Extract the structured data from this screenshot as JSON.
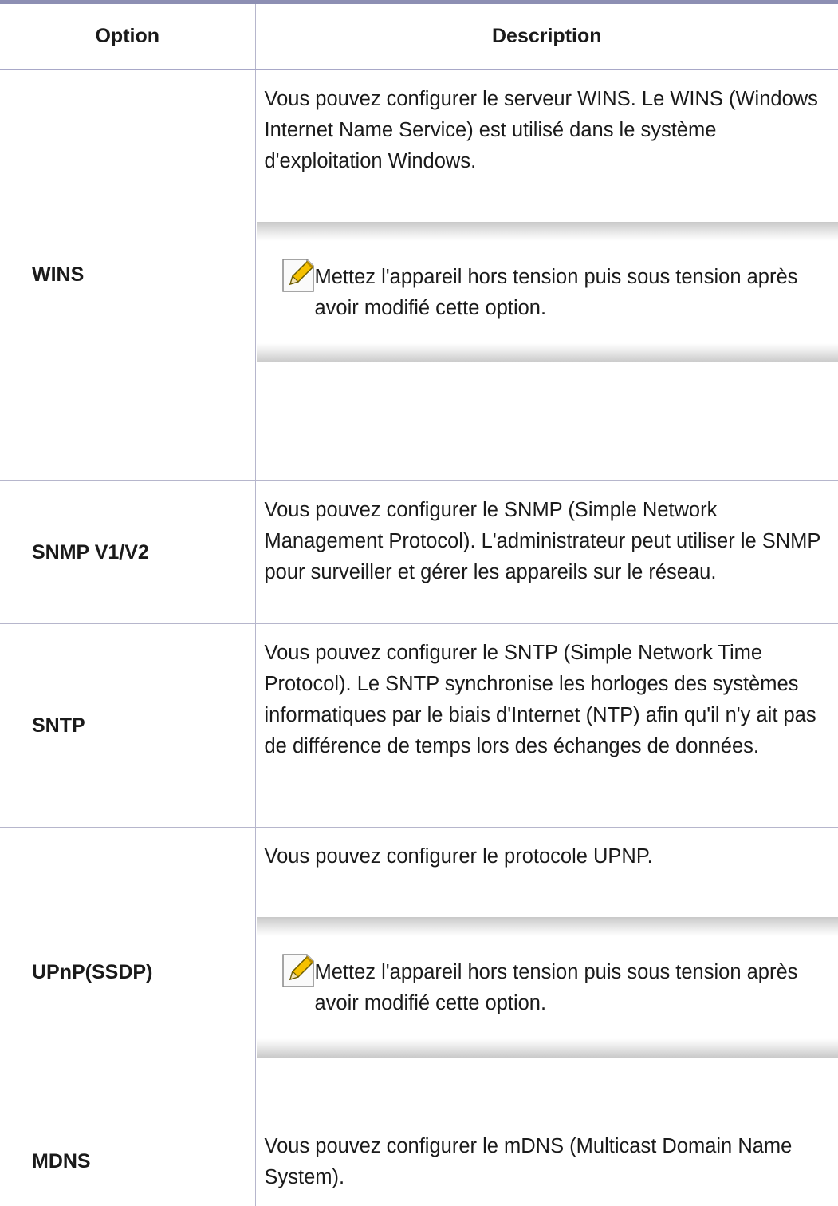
{
  "table": {
    "headers": {
      "option": "Option",
      "description": "Description"
    },
    "rows": [
      {
        "option": "WINS",
        "description": "Vous pouvez configurer le serveur WINS. Le WINS (Windows Internet Name Service) est utilisé dans le système d'exploitation Windows.",
        "note": "Mettez l'appareil hors tension puis sous tension après avoir modifié cette option."
      },
      {
        "option": "SNMP V1/V2",
        "description": "Vous pouvez configurer le SNMP (Simple Network Management Protocol). L'administrateur peut utiliser le SNMP pour surveiller et gérer les appareils sur le réseau."
      },
      {
        "option": "SNTP",
        "description": "Vous pouvez configurer le SNTP (Simple Network Time Protocol). Le SNTP synchronise les horloges des systèmes informatiques par le biais d'Internet (NTP) afin qu'il n'y ait pas de différence de temps lors des échanges de données."
      },
      {
        "option": "UPnP(SSDP)",
        "description": "Vous pouvez configurer le protocole UPNP.",
        "note": "Mettez l'appareil hors tension puis sous tension après avoir modifié cette option."
      },
      {
        "option": "MDNS",
        "description": "Vous pouvez configurer le mDNS (Multicast Domain Name System)."
      }
    ]
  },
  "icons": {
    "note": "note-pencil-icon"
  },
  "colors": {
    "header_rule": "#8d8fb3",
    "cell_border": "#b6b6cc",
    "note_shade": "#c9c9c9"
  }
}
